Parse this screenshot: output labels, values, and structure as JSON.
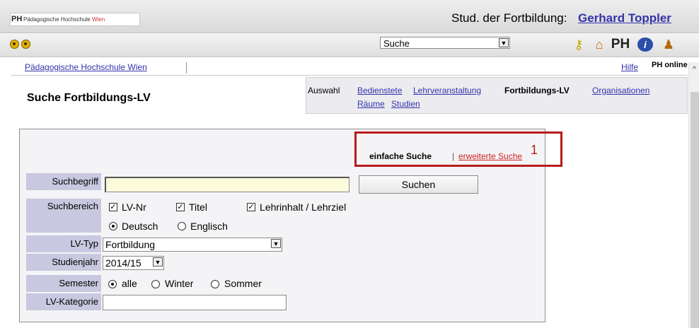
{
  "header": {
    "logo_text": "Pädagogische Hochschule",
    "logo_accent": "Wien",
    "logo_mark": "PH",
    "user_label": "Stud. der Fortbildung:",
    "user_name": "Gerhard Toppler"
  },
  "toolbar": {
    "search_select_value": "Suche",
    "icons": [
      "back-icon",
      "forward-icon",
      "key-icon",
      "home-icon",
      "ph-wien-icon",
      "info-icon",
      "users-icon"
    ],
    "ph_icon_text": "PH",
    "info_icon_text": "i"
  },
  "breadcrumb": {
    "home": "Pädagogische Hochschule Wien",
    "help": "Hilfe",
    "online_logo": "PH online"
  },
  "page": {
    "title": "Suche Fortbildungs-LV"
  },
  "auswahl": {
    "label": "Auswahl",
    "tabs": {
      "bedienstete": "Bedienstete",
      "lehrveranstaltung": "Lehrveranstaltung",
      "fortbildungs": "Fortbildungs-LV",
      "organisationen": "Organisationen",
      "raeume": "Räume",
      "studien": "Studien"
    }
  },
  "search": {
    "simple": "einfache Suche",
    "separator": "|",
    "advanced": "erweiterte Suche",
    "marker": "1",
    "fields": {
      "suchbegriff_label": "Suchbegriff",
      "suchbegriff_value": "",
      "suchen_button": "Suchen",
      "suchbereich_label": "Suchbereich",
      "opt_lvnr": "LV-Nr",
      "opt_titel": "Titel",
      "opt_lehrinhalt": "Lehrinhalt / Lehrziel",
      "opt_deutsch": "Deutsch",
      "opt_englisch": "Englisch",
      "lvtyp_label": "LV-Typ",
      "lvtyp_value": "Fortbildung",
      "studienjahr_label": "Studienjahr",
      "studienjahr_value": "2014/15",
      "semester_label": "Semester",
      "opt_alle": "alle",
      "opt_winter": "Winter",
      "opt_sommer": "Sommer",
      "lvkategorie_label": "LV-Kategorie",
      "lvkategorie_value": ""
    }
  },
  "colors": {
    "link": "#3333aa",
    "highlight": "#b71c1c",
    "label_bg": "#c8c8e0",
    "input_bg": "#fbfbdc"
  }
}
